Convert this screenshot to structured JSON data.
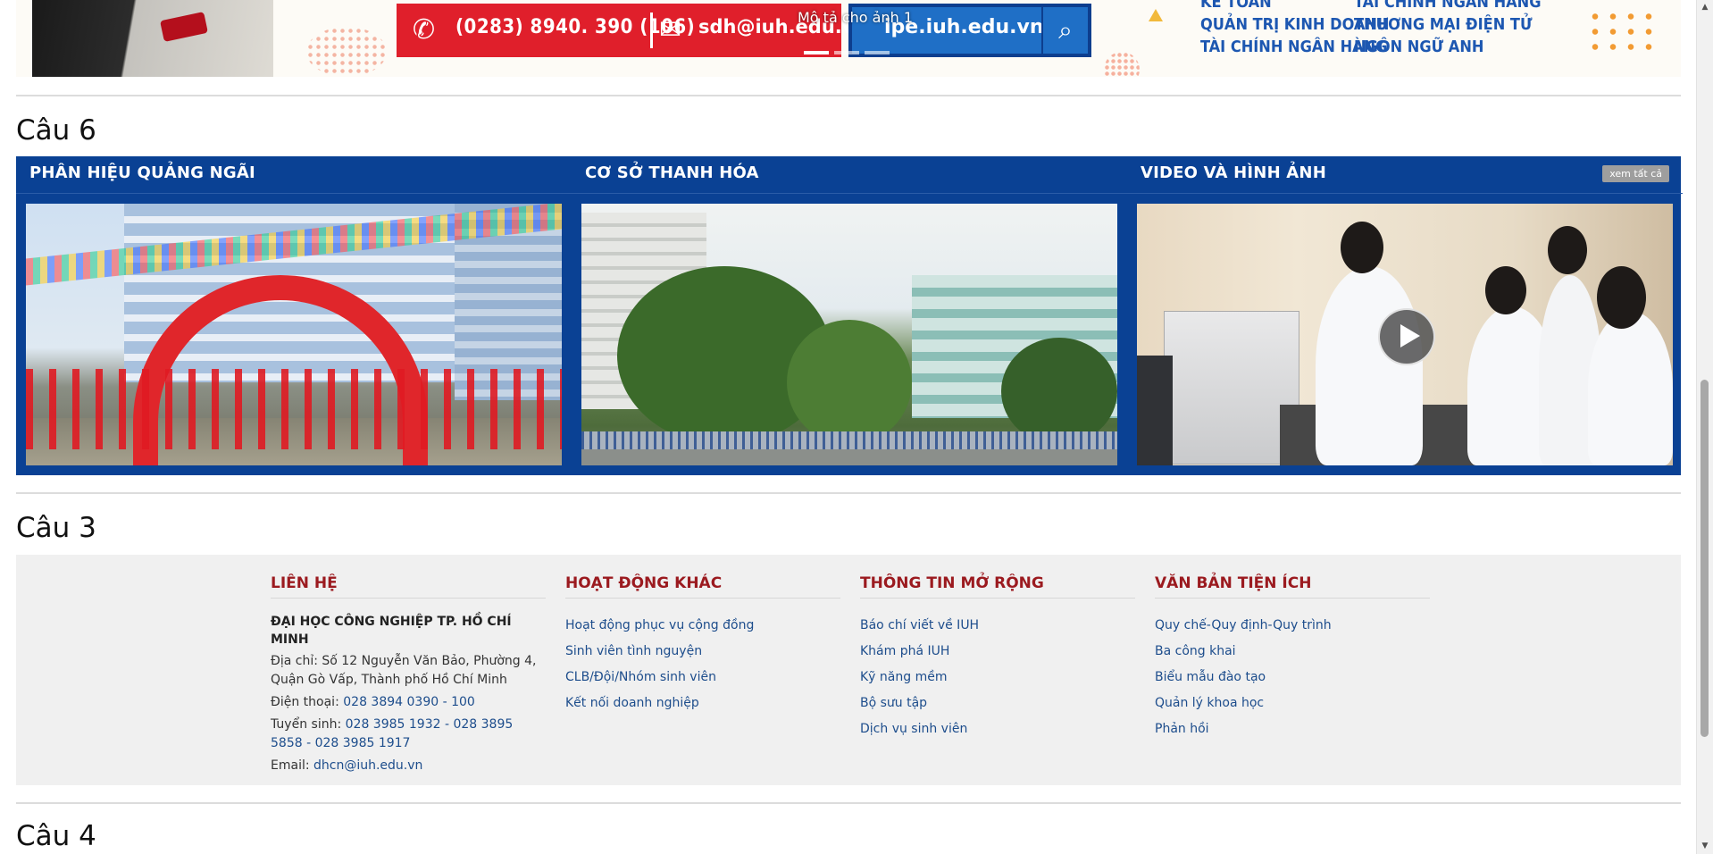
{
  "banner": {
    "phone": "(0283) 8940. 390 (106)",
    "email": "sdh@iuh.edu.vn",
    "site": "ipe.iuh.edu.vn",
    "caption": "Mô tả cho ảnh 1",
    "majors": [
      [
        "KẾ TOÁN",
        "TÀI CHÍNH NGÂN HÀNG"
      ],
      [
        "QUẢN TRỊ KINH DOANH",
        "THƯƠNG MẠI ĐIỆN TỬ"
      ],
      [
        "TÀI CHÍNH NGÂN HÀNG",
        "NGÔN NGỮ ANH"
      ]
    ],
    "slide_count": 3,
    "active_slide": 1
  },
  "sections": {
    "s6": "Câu 6",
    "s3": "Câu 3",
    "s4": "Câu 4"
  },
  "panel": {
    "col1_title": "PHÂN HIỆU QUẢNG NGÃI",
    "col2_title": "CƠ SỞ THANH HÓA",
    "col3_title": "VIDEO VÀ HÌNH ẢNH",
    "see_all": "xem tất cả"
  },
  "footer": {
    "contact": {
      "heading": "LIÊN HỆ",
      "org": "ĐẠI HỌC CÔNG NGHIỆP TP. HỒ CHÍ MINH",
      "address_label": "Địa chỉ:",
      "address": "Số 12 Nguyễn Văn Bảo, Phường 4, Quận Gò Vấp, Thành phố Hồ Chí Minh",
      "phone_label": "Điện thoại:",
      "phone": "028 3894 0390 - 100",
      "admission_label": "Tuyển sinh:",
      "admission": "028 3985 1932 - 028 3895 5858 - 028 3985 1917",
      "email_label": "Email:",
      "email": "dhcn@iuh.edu.vn"
    },
    "activities": {
      "heading": "HOẠT ĐỘNG KHÁC",
      "items": [
        "Hoạt động phục vụ cộng đồng",
        "Sinh viên tình nguyện",
        "CLB/Đội/Nhóm sinh viên",
        "Kết nối doanh nghiệp"
      ]
    },
    "more_info": {
      "heading": "THÔNG TIN MỞ RỘNG",
      "items": [
        "Báo chí viết về IUH",
        "Khám phá IUH",
        "Kỹ năng mềm",
        "Bộ sưu tập",
        "Dịch vụ sinh viên"
      ]
    },
    "documents": {
      "heading": "VĂN BẢN TIỆN ÍCH",
      "items": [
        "Quy chế-Quy định-Quy trình",
        "Ba công khai",
        "Biểu mẫu đào tạo",
        "Quản lý khoa học",
        "Phản hồi"
      ]
    }
  },
  "colors": {
    "panel_blue": "#0a4194",
    "footer_heading": "#9b1a1f",
    "link": "#1d4d8c",
    "footer_bg": "#f0f0f0"
  }
}
